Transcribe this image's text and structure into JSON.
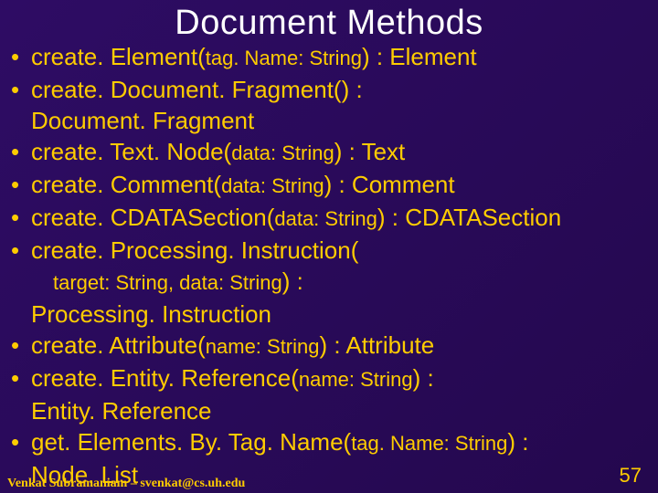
{
  "title": "Document Methods",
  "items": [
    {
      "method": "create. Element(",
      "param": "tag. Name: String",
      "after": ") : Element"
    },
    {
      "method": "create. Document. Fragment() :",
      "param": "",
      "after": "",
      "return_line": "Document. Fragment"
    },
    {
      "method": "create. Text. Node(",
      "param": "data: String",
      "after": ") : Text"
    },
    {
      "method": "create. Comment(",
      "param": "data: String",
      "after": ") : Comment"
    },
    {
      "method": "create. CDATASection(",
      "param": "data: String",
      "after": ") : CDATASection"
    },
    {
      "method": "create. Processing. Instruction(",
      "param": "",
      "after": "",
      "param_line": "target: String, data: String",
      "param_after": ") :",
      "return_line": "Processing. Instruction"
    },
    {
      "method": "create. Attribute(",
      "param": "name: String",
      "after": ") : Attribute"
    },
    {
      "method": "create. Entity. Reference(",
      "param": "name: String",
      "after": ") :",
      "return_line": "Entity. Reference"
    },
    {
      "method": "get. Elements. By. Tag. Name(",
      "param": "tag. Name: String",
      "after": ") :",
      "return_line": "Node. List"
    }
  ],
  "footer": "Venkat Subramaniam – svenkat@cs.uh.edu",
  "page": "57"
}
